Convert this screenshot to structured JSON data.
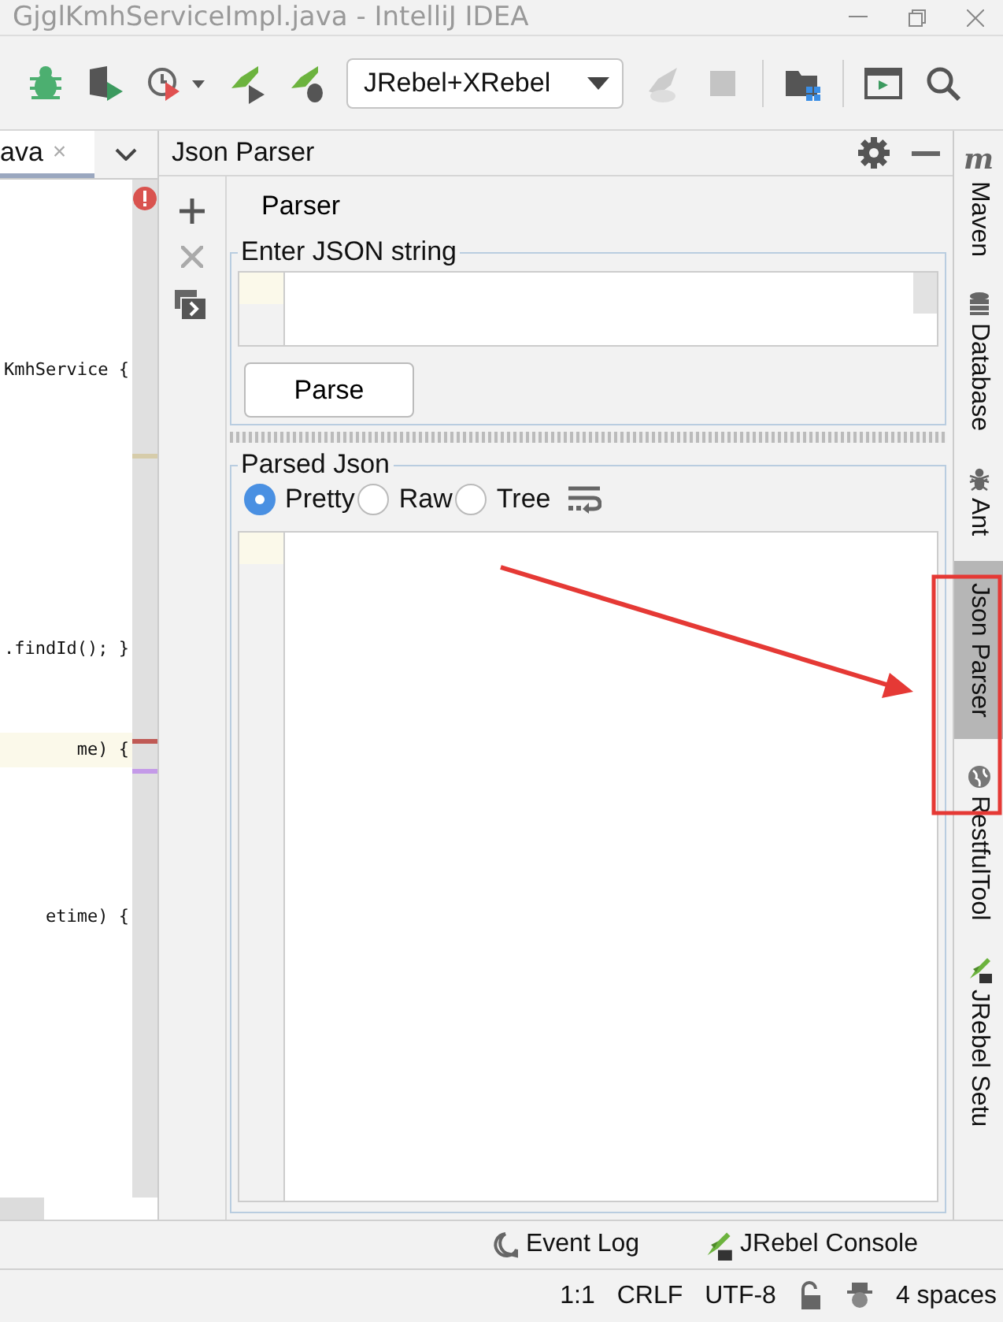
{
  "window": {
    "title": "GjglKmhServiceImpl.java - IntelliJ IDEA"
  },
  "toolbar": {
    "run_config": "JRebel+XRebel"
  },
  "editor": {
    "tab": {
      "label": "ava",
      "close": "×",
      "selected": true
    },
    "code_lines": [
      {
        "text": "KmhService {",
        "highlight": false
      },
      {
        "text": ".findId(); }",
        "highlight": false
      },
      {
        "text": "me) {",
        "highlight": true
      },
      {
        "text": "etime) {",
        "highlight": false
      }
    ]
  },
  "tool_window": {
    "title": "Json Parser",
    "tabs": [
      {
        "label": "Parser",
        "selected": true
      }
    ],
    "input_group": {
      "title": "Enter JSON string",
      "button": "Parse"
    },
    "output_group": {
      "title": "Parsed Json",
      "modes": [
        {
          "label": "Pretty",
          "selected": true
        },
        {
          "label": "Raw",
          "selected": false
        },
        {
          "label": "Tree",
          "selected": false
        }
      ]
    }
  },
  "side_tabs": [
    {
      "label": "Maven",
      "glyph": "m",
      "selected": false
    },
    {
      "label": "Database",
      "selected": false
    },
    {
      "label": "Ant",
      "selected": false
    },
    {
      "label": "Json Parser",
      "selected": true
    },
    {
      "label": "RestfulTool",
      "selected": false
    },
    {
      "label": "JRebel Setu",
      "selected": false
    }
  ],
  "bottom_tools": [
    {
      "label": "Event Log"
    },
    {
      "label": "JRebel Console"
    }
  ],
  "status_bar": {
    "position": "1:1",
    "line_separator": "CRLF",
    "encoding": "UTF-8",
    "indent": "4 spaces"
  }
}
